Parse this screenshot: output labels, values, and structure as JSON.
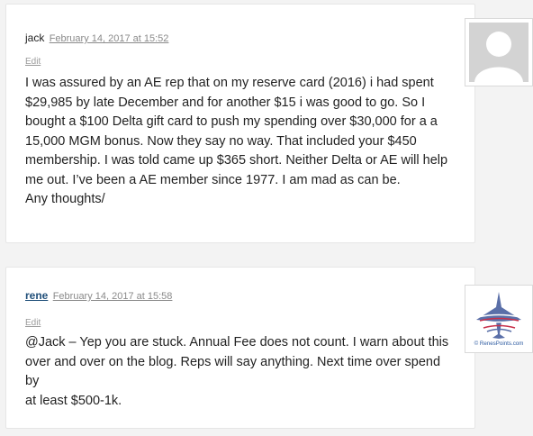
{
  "comments": [
    {
      "author": "jack",
      "date": "February 14, 2017 at 15:52",
      "edit_label": "Edit",
      "body": "I was assured by an AE rep that on my reserve card (2016) i had spent\n$29,985 by late December and for another $15 i was good to go. So I\nbought a $100 Delta gift card to push my spending over $30,000 for a a\n15,000 MGM bonus. Now they say no way. That included your $450\nmembership. I was told came up $365 short. Neither Delta or AE will help\nme out. I’ve been a AE member since 1977. I am mad as can be.\nAny thoughts/",
      "avatar": "default-avatar-icon"
    },
    {
      "author": "rene",
      "date": "February 14, 2017 at 15:58",
      "edit_label": "Edit",
      "body": "@Jack – Yep you are stuck. Annual Fee does not count. I warn about this\nover and over on the blog. Reps will say anything. Next time over spend by\nat least $500-1k.",
      "avatar_text": "© RenesPoints.com"
    }
  ]
}
